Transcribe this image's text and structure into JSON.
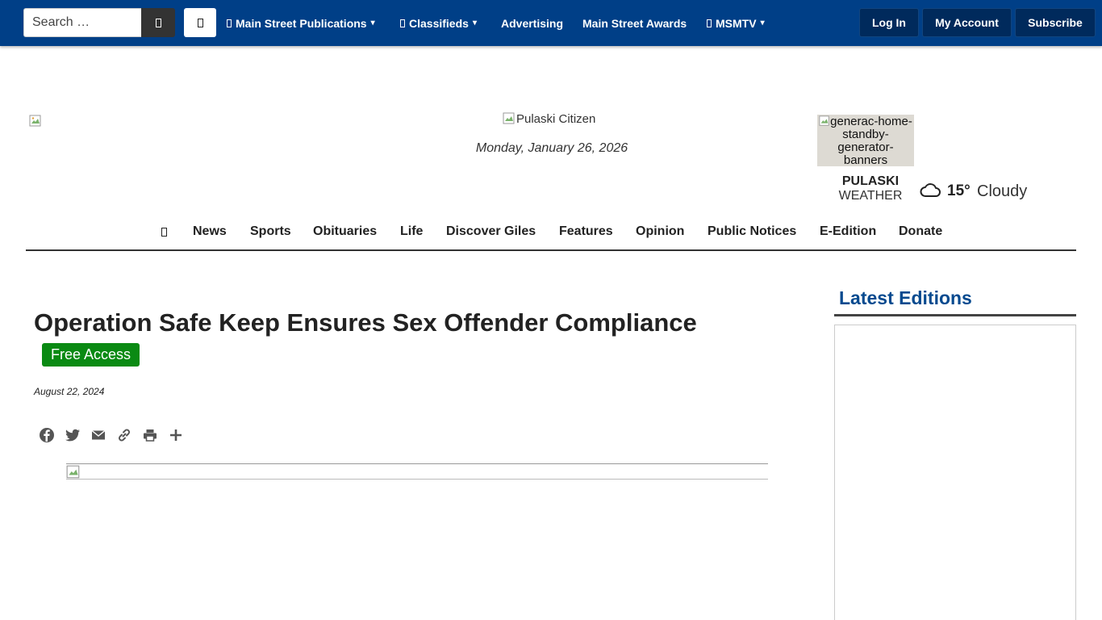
{
  "topbar": {
    "search_placeholder": "Search …",
    "nav": [
      {
        "label": "Main Street Publications",
        "has_icon": true,
        "caret": "▾"
      },
      {
        "label": "Classifieds",
        "has_icon": true,
        "caret": "▾"
      },
      {
        "label": "Advertising"
      },
      {
        "label": "Main Street Awards"
      },
      {
        "label": "MSMTV",
        "has_icon": true,
        "caret": "▾"
      }
    ],
    "account_buttons": [
      "Log In",
      "My Account",
      "Subscribe"
    ],
    "colors": {
      "bar": "#003f87",
      "button": "#002a5c"
    }
  },
  "header": {
    "logo_alt": "Pulaski Citizen",
    "date": "Monday, January 26, 2026",
    "ad_alt": "generac-home-standby-generator-banners",
    "weather": {
      "city": "PULASKI",
      "word": "WEATHER",
      "icon": "cloud-icon",
      "temperature": "15°",
      "condition": "Cloudy"
    }
  },
  "main_nav": {
    "items": [
      "News",
      "Sports",
      "Obituaries",
      "Life",
      "Discover Giles",
      "Features",
      "Opinion",
      "Public Notices",
      "E-Edition",
      "Donate"
    ]
  },
  "article": {
    "headline": "Operation Safe Keep Ensures Sex Offender Compliance",
    "badge": "Free Access",
    "badge_color": "#0a8a13",
    "date": "August 22, 2024",
    "share_icons": [
      "facebook-icon",
      "twitter-icon",
      "email-icon",
      "copy-link-icon",
      "print-icon",
      "more-share-icon"
    ]
  },
  "sidebar": {
    "title": "Latest Editions",
    "title_color": "#064a8f"
  }
}
